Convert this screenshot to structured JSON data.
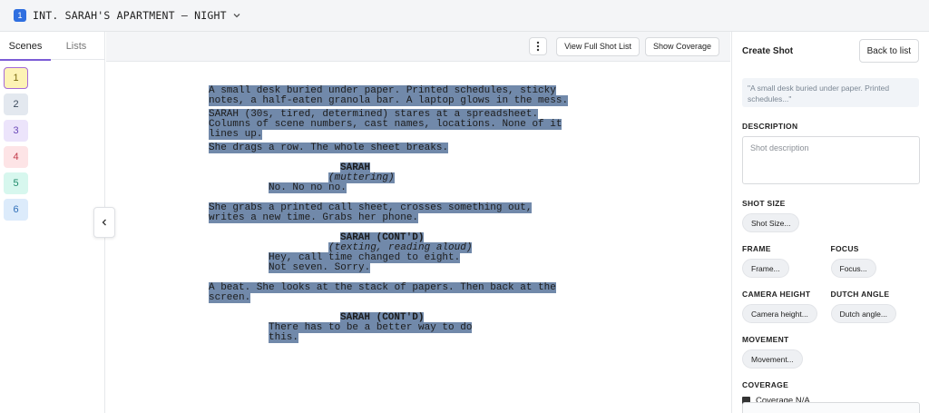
{
  "topbar": {
    "scene_number": "1",
    "scene_heading": "INT. SARAH'S APARTMENT – NIGHT"
  },
  "left_panel": {
    "tabs": [
      {
        "label": "Scenes",
        "active": true
      },
      {
        "label": "Lists",
        "active": false
      }
    ],
    "scenes": [
      {
        "label": "1",
        "bg": "#fdf3b5",
        "border": "#a66ad8",
        "color": "#7a6a10"
      },
      {
        "label": "2",
        "bg": "#e3e8ef",
        "border": "#e3e8ef",
        "color": "#3c4a5c"
      },
      {
        "label": "3",
        "bg": "#ece4fb",
        "border": "#ece4fb",
        "color": "#6a48b8"
      },
      {
        "label": "4",
        "bg": "#fde4e6",
        "border": "#fde4e6",
        "color": "#c23a4a"
      },
      {
        "label": "5",
        "bg": "#d7f7ee",
        "border": "#d7f7ee",
        "color": "#1f8a6a"
      },
      {
        "label": "6",
        "bg": "#dcebfb",
        "border": "#dcebfb",
        "color": "#2f6fb8"
      }
    ]
  },
  "toolbar": {
    "view_full_shot_list": "View Full Shot List",
    "show_coverage": "Show Coverage"
  },
  "script": {
    "action1": [
      "A small desk buried under paper. Printed schedules, sticky",
      "notes, a half-eaten granola bar. A laptop glows in the mess."
    ],
    "action2": [
      "SARAH (30s, tired, determined) stares at a spreadsheet.",
      "Columns of scene numbers, cast names, locations. None of it",
      "lines up."
    ],
    "action3": [
      "She drags a row. The whole sheet breaks."
    ],
    "char1": "SARAH",
    "paren1": "(muttering)",
    "dlg1": [
      "No. No no no."
    ],
    "action4": [
      "She grabs a printed call sheet, crosses something out,",
      "writes a new time. Grabs her phone."
    ],
    "char2": "SARAH (CONT'D)",
    "paren2": "(texting, reading aloud)",
    "dlg2": [
      "Hey, call time changed to eight.",
      "Not seven. Sorry."
    ],
    "action5": [
      "A beat. She looks at the stack of papers. Then back at the",
      "screen."
    ],
    "char3": "SARAH (CONT'D)",
    "dlg3": [
      "There has to be a better way to do",
      "this."
    ]
  },
  "right_panel": {
    "title": "Create Shot",
    "back_label": "Back to list",
    "quote": "\"A small desk buried under paper. Printed schedules...\"",
    "description_label": "DESCRIPTION",
    "description_placeholder": "Shot description",
    "shot_size_label": "SHOT SIZE",
    "shot_size_btn": "Shot Size...",
    "frame_label": "FRAME",
    "frame_btn": "Frame...",
    "focus_label": "FOCUS",
    "focus_btn": "Focus...",
    "camera_height_label": "CAMERA HEIGHT",
    "camera_height_btn": "Camera height...",
    "dutch_angle_label": "DUTCH ANGLE",
    "dutch_angle_btn": "Dutch angle...",
    "movement_label": "MOVEMENT",
    "movement_btn": "Movement...",
    "coverage_label": "COVERAGE",
    "coverage_na": "Coverage N/A"
  }
}
